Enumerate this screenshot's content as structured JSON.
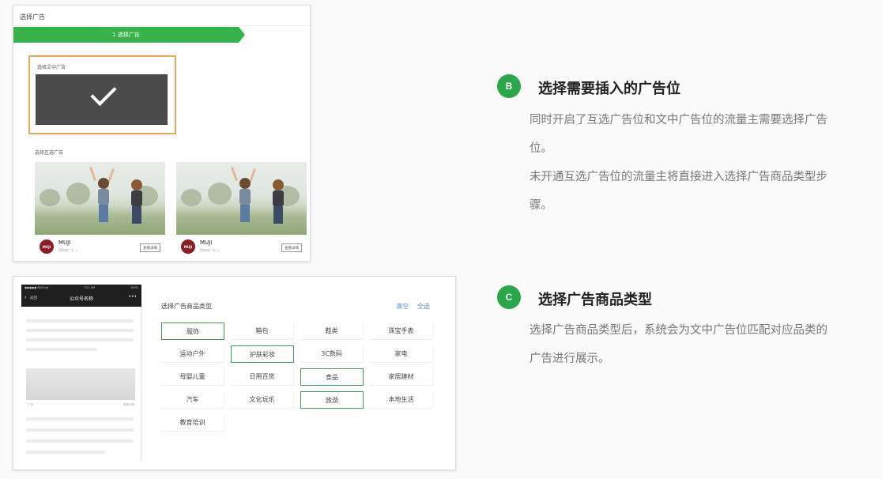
{
  "panel_b": {
    "title": "选择广告",
    "step_label": "1 选择广告",
    "inline_label": "选择文中广告",
    "inline_tag": "",
    "mutual_label": "选择互选广告",
    "cards": [
      {
        "logo": "MUJI",
        "brand": "MUJI",
        "sub": "赞助商广告 ∨",
        "button": "查看详情"
      },
      {
        "logo": "MUJI",
        "brand": "MUJI",
        "sub": "赞助商广告 ∨",
        "button": "查看详情"
      }
    ]
  },
  "panel_c": {
    "phone": {
      "status_left": "●●●●● WeChat",
      "status_center": "7:21 AM",
      "status_right": "100%",
      "back_label": "返回",
      "title": "公众号名称",
      "more": "•••",
      "caption_left": "广告",
      "caption_right": "查看详情"
    },
    "heading": "选择广告商品类型",
    "clear_label": "清空",
    "select_all_label": "全选",
    "categories": [
      {
        "label": "服饰",
        "selected": true
      },
      {
        "label": "箱包",
        "selected": false
      },
      {
        "label": "鞋类",
        "selected": false
      },
      {
        "label": "珠宝手表",
        "selected": false
      },
      {
        "label": "运动户外",
        "selected": false
      },
      {
        "label": "护肤彩妆",
        "selected": true
      },
      {
        "label": "3C数码",
        "selected": false
      },
      {
        "label": "家电",
        "selected": false
      },
      {
        "label": "母婴儿童",
        "selected": false
      },
      {
        "label": "日用百货",
        "selected": false
      },
      {
        "label": "食品",
        "selected": true
      },
      {
        "label": "家居建材",
        "selected": false
      },
      {
        "label": "汽车",
        "selected": false
      },
      {
        "label": "文化玩乐",
        "selected": false
      },
      {
        "label": "旅游",
        "selected": true
      },
      {
        "label": "本地生活",
        "selected": false
      },
      {
        "label": "教育培训",
        "selected": false
      }
    ]
  },
  "section_b": {
    "badge": "B",
    "title": "选择需要插入的广告位",
    "lines": [
      "同时开启了互选广告位和文中广告位的流量主需要选择广告",
      "位。",
      "未开通互选广告位的流量主将直接进入选择广告商品类型步",
      "骤。"
    ]
  },
  "section_c": {
    "badge": "C",
    "title": "选择广告商品类型",
    "lines": [
      "选择广告商品类型后，系统会为文中广告位匹配对应品类的",
      "广告进行展示。"
    ]
  },
  "colors": {
    "brand_green": "#2aa64b",
    "step_green": "#38b24a",
    "selected_border": "#e6a85b",
    "link_blue": "#5b8fd6",
    "muji_red": "#8a1e23"
  }
}
